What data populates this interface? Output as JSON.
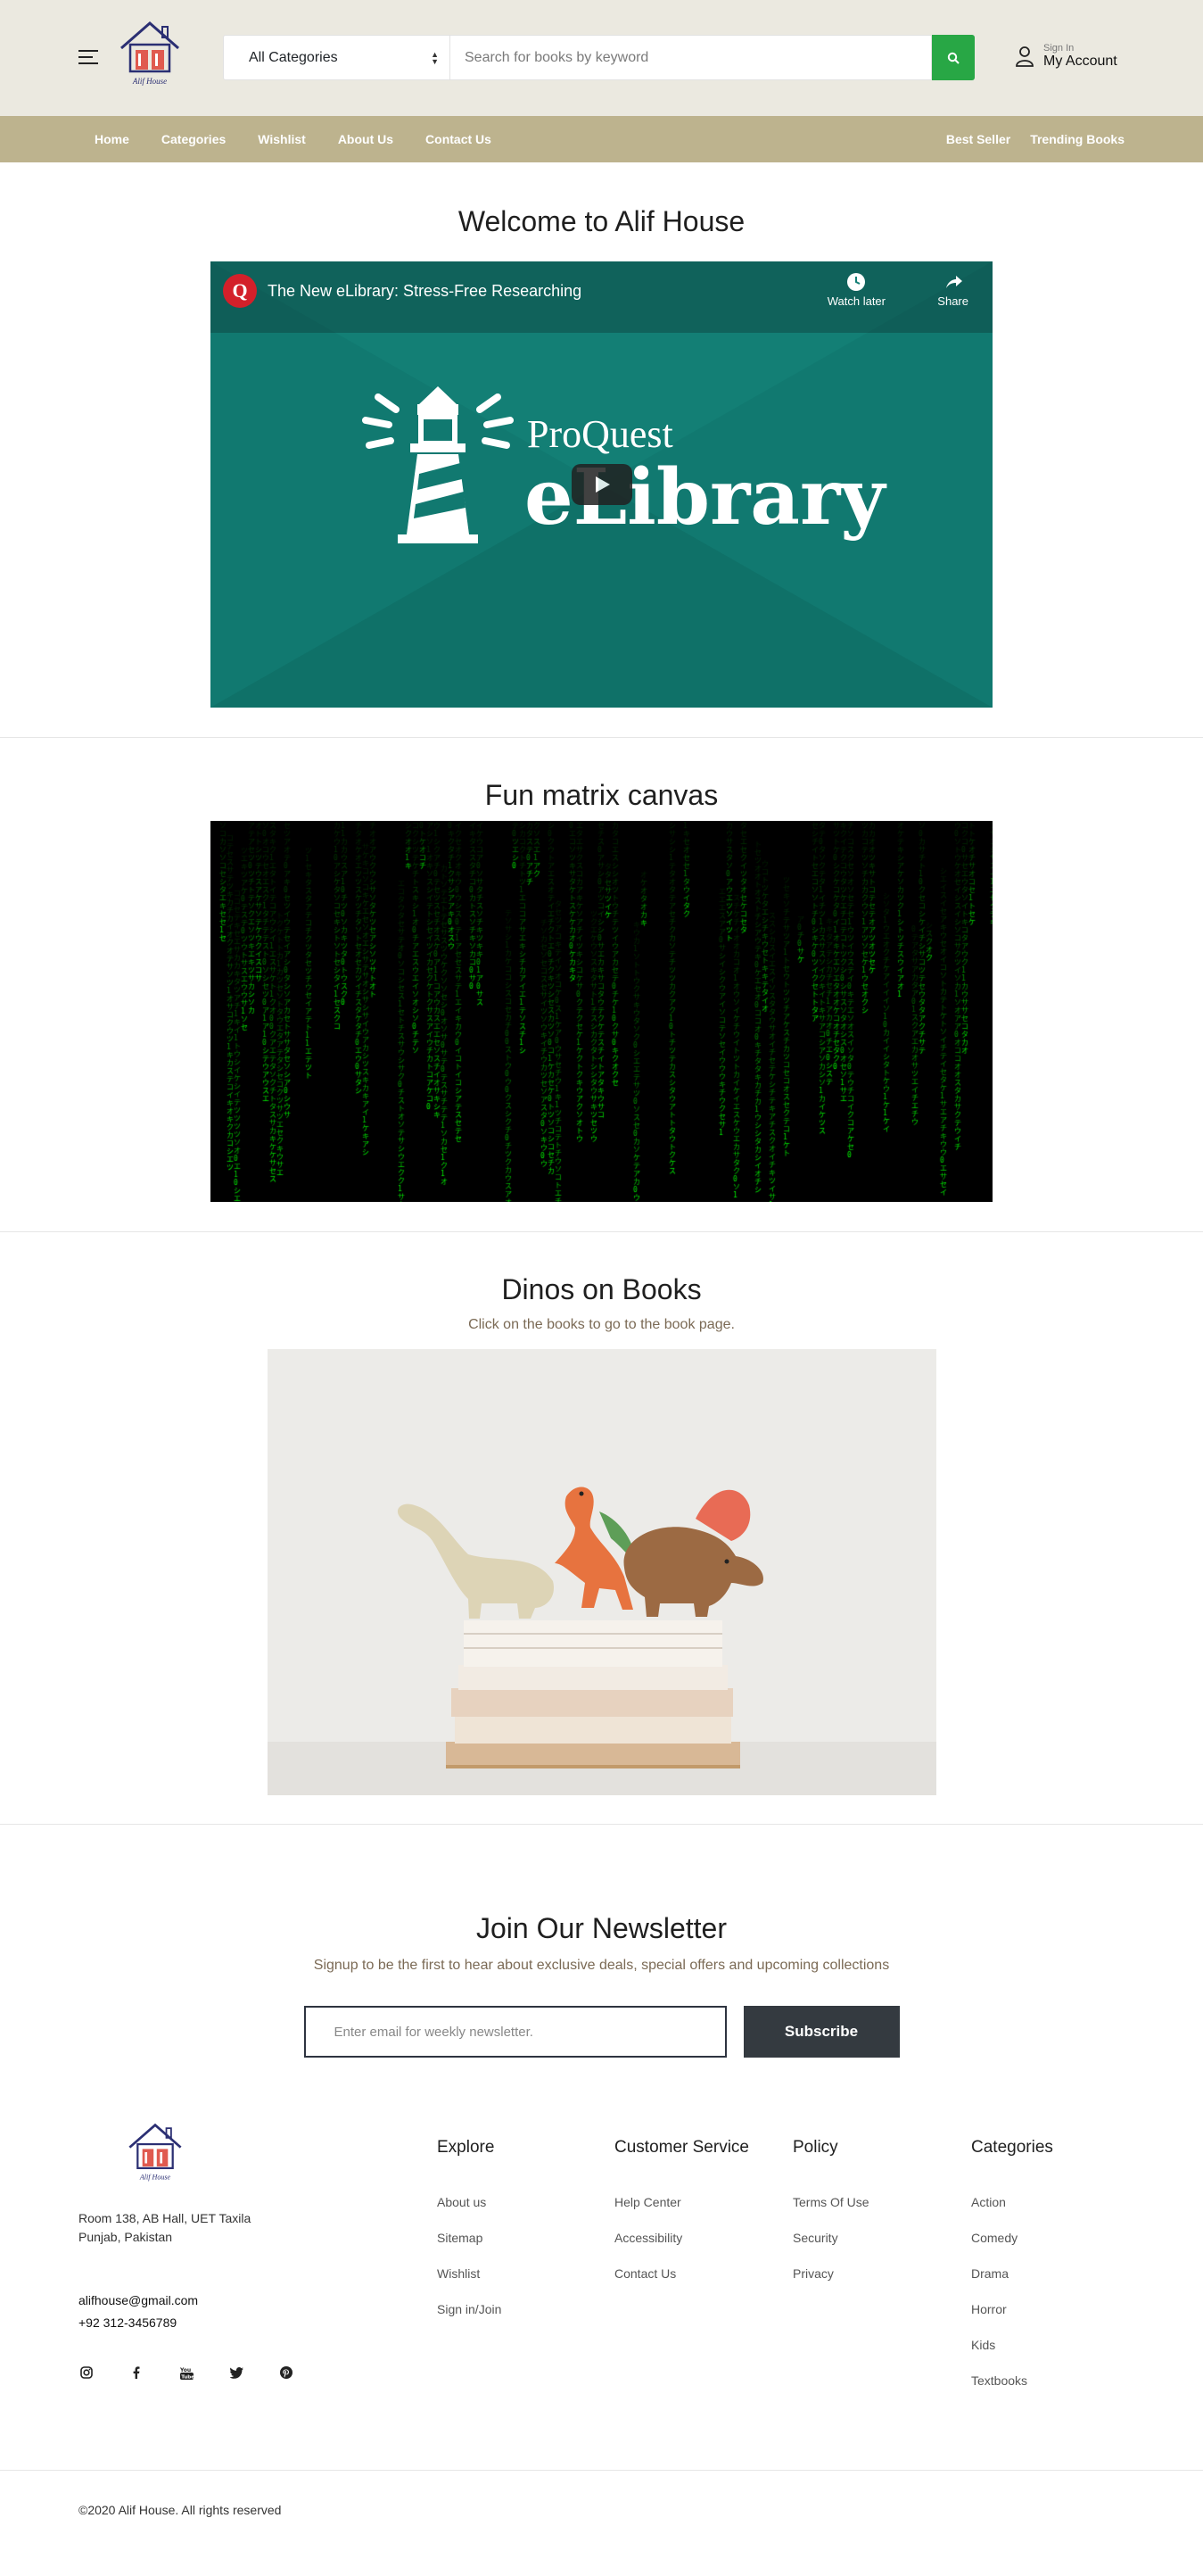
{
  "header": {
    "logo_text": "Alif House",
    "category_select": "All Categories",
    "search_placeholder": "Search for books by keyword",
    "account_sub": "Sign In",
    "account_main": "My Account"
  },
  "nav": {
    "left": [
      "Home",
      "Categories",
      "Wishlist",
      "About Us",
      "Contact Us"
    ],
    "right": [
      "Best Seller",
      "Trending Books"
    ]
  },
  "welcome": {
    "title": "Welcome to Alif House",
    "video": {
      "title": "The New eLibrary: Stress-Free Researching",
      "watch_later": "Watch later",
      "share": "Share",
      "brand_top": "ProQuest",
      "brand_main": "eLibrary"
    }
  },
  "matrix": {
    "title": "Fun matrix canvas"
  },
  "dinos": {
    "title": "Dinos on Books",
    "subtitle": "Click on the books to go to the book page."
  },
  "newsletter": {
    "title": "Join Our Newsletter",
    "subtitle": "Signup to be the first to hear about exclusive deals, special offers and upcoming collections",
    "placeholder": "Enter email for weekly newsletter.",
    "button": "Subscribe"
  },
  "footer": {
    "logo_text": "Alif House",
    "address_line1": "Room 138, AB Hall, UET Taxila",
    "address_line2": "Punjab, Pakistan",
    "email": "alifhouse@gmail.com",
    "phone": "+92 312-3456789",
    "social": [
      "instagram-icon",
      "facebook-icon",
      "youtube-icon",
      "twitter-icon",
      "pinterest-icon"
    ],
    "columns": [
      {
        "title": "Explore",
        "links": [
          "About us",
          "Sitemap",
          "Wishlist",
          "Sign in/Join"
        ]
      },
      {
        "title": "Customer Service",
        "links": [
          "Help Center",
          "Accessibility",
          "Contact Us"
        ]
      },
      {
        "title": "Policy",
        "links": [
          "Terms Of Use",
          "Security",
          "Privacy"
        ]
      },
      {
        "title": "Categories",
        "links": [
          "Action",
          "Comedy",
          "Drama",
          "Horror",
          "Kids",
          "Textbooks"
        ]
      }
    ],
    "copyright": "©2020 Alif House. All rights reserved"
  },
  "colors": {
    "topbar": "#ebe9e0",
    "nav": "#bdb38e",
    "search_button": "#28a745",
    "video_teal": "#117970",
    "subscribe": "#343a40"
  }
}
